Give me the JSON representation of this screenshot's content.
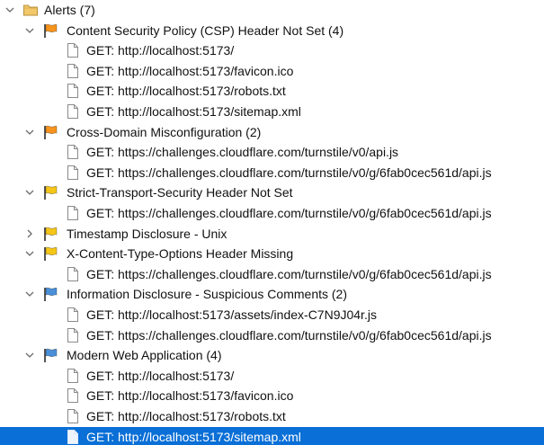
{
  "root": {
    "label": "Alerts (7)",
    "icon": "folder-icon",
    "expanded": true
  },
  "alerts": [
    {
      "label": "Content Security Policy (CSP) Header Not Set (4)",
      "flag_color": "#f7941d",
      "risk": "medium",
      "expanded": true,
      "items": [
        "GET: http://localhost:5173/",
        "GET: http://localhost:5173/favicon.ico",
        "GET: http://localhost:5173/robots.txt",
        "GET: http://localhost:5173/sitemap.xml"
      ]
    },
    {
      "label": "Cross-Domain Misconfiguration (2)",
      "flag_color": "#f7941d",
      "risk": "medium",
      "expanded": true,
      "items": [
        "GET: https://challenges.cloudflare.com/turnstile/v0/api.js",
        "GET: https://challenges.cloudflare.com/turnstile/v0/g/6fab0cec561d/api.js"
      ]
    },
    {
      "label": "Strict-Transport-Security Header Not Set",
      "flag_color": "#f5c518",
      "risk": "low",
      "expanded": true,
      "items": [
        "GET: https://challenges.cloudflare.com/turnstile/v0/g/6fab0cec561d/api.js"
      ]
    },
    {
      "label": "Timestamp Disclosure - Unix",
      "flag_color": "#f5c518",
      "risk": "low",
      "expanded": false,
      "items": []
    },
    {
      "label": "X-Content-Type-Options Header Missing",
      "flag_color": "#f5c518",
      "risk": "low",
      "expanded": true,
      "items": [
        "GET: https://challenges.cloudflare.com/turnstile/v0/g/6fab0cec561d/api.js"
      ]
    },
    {
      "label": "Information Disclosure - Suspicious Comments (2)",
      "flag_color": "#4a8fd8",
      "risk": "informational",
      "expanded": true,
      "items": [
        "GET: http://localhost:5173/assets/index-C7N9J04r.js",
        "GET: https://challenges.cloudflare.com/turnstile/v0/g/6fab0cec561d/api.js"
      ]
    },
    {
      "label": "Modern Web Application (4)",
      "flag_color": "#4a8fd8",
      "risk": "informational",
      "expanded": true,
      "items": [
        "GET: http://localhost:5173/",
        "GET: http://localhost:5173/favicon.ico",
        "GET: http://localhost:5173/robots.txt",
        "GET: http://localhost:5173/sitemap.xml"
      ]
    }
  ],
  "selected": "alerts.6.items.3",
  "colors": {
    "selection": "#0a6fd6",
    "folder": "#f2c86b"
  },
  "icons": {
    "expanded": "chevron-down-icon",
    "collapsed": "chevron-right-icon",
    "alert": "flag-icon",
    "item": "page-icon"
  }
}
